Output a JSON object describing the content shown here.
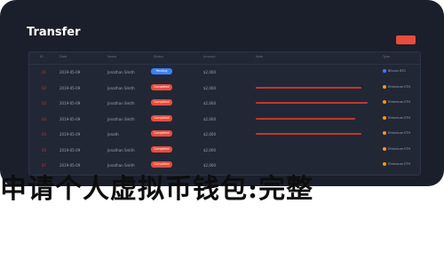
{
  "app": {
    "title": "Transfer",
    "top_button_color": "#e74c3c"
  },
  "table": {
    "columns": [
      "ID",
      "Date",
      "Name",
      "Status",
      "Amount",
      "Note",
      "Type"
    ],
    "rows": [
      {
        "id": "01",
        "date": "2019-05-09",
        "name": "Jonathan Smith",
        "pill": "Pending",
        "pill_color": "#3b82f6",
        "amount": "$2,000",
        "bar_frac": 0.0,
        "status": "Bitcoin BTC",
        "dot": "#3b82f6"
      },
      {
        "id": "02",
        "date": "2019-05-09",
        "name": "Jonathan Smith",
        "pill": "Completed",
        "pill_color": "#e74c3c",
        "amount": "$2,000",
        "bar_frac": 0.85,
        "status": "Ethereum ETH",
        "dot": "#f39c12"
      },
      {
        "id": "03",
        "date": "2019-05-09",
        "name": "Jonathan Smith",
        "pill": "Completed",
        "pill_color": "#e74c3c",
        "amount": "$2,000",
        "bar_frac": 0.9,
        "status": "Ethereum ETH",
        "dot": "#f39c12"
      },
      {
        "id": "04",
        "date": "2019-05-09",
        "name": "Jonathan Smith",
        "pill": "Completed",
        "pill_color": "#e74c3c",
        "amount": "$2,000",
        "bar_frac": 0.8,
        "status": "Ethereum ETH",
        "dot": "#f39c12"
      },
      {
        "id": "05",
        "date": "2019-05-09",
        "name": "Jonath",
        "pill": "Completed",
        "pill_color": "#e74c3c",
        "amount": "$2,000",
        "bar_frac": 0.85,
        "status": "Ethereum ETH",
        "dot": "#f39c12"
      },
      {
        "id": "06",
        "date": "2019-05-09",
        "name": "Jonathan Smith",
        "pill": "Completed",
        "pill_color": "#e74c3c",
        "amount": "$2,000",
        "bar_frac": 0.0,
        "status": "Ethereum ETH",
        "dot": "#f39c12"
      },
      {
        "id": "07",
        "date": "2019-05-09",
        "name": "Jonathan Smith",
        "pill": "Completed",
        "pill_color": "#e74c3c",
        "amount": "$2,000",
        "bar_frac": 0.0,
        "status": "Ethereum ETH",
        "dot": "#f39c12"
      }
    ]
  },
  "headline": "申请个人虚拟币钱包:完整"
}
